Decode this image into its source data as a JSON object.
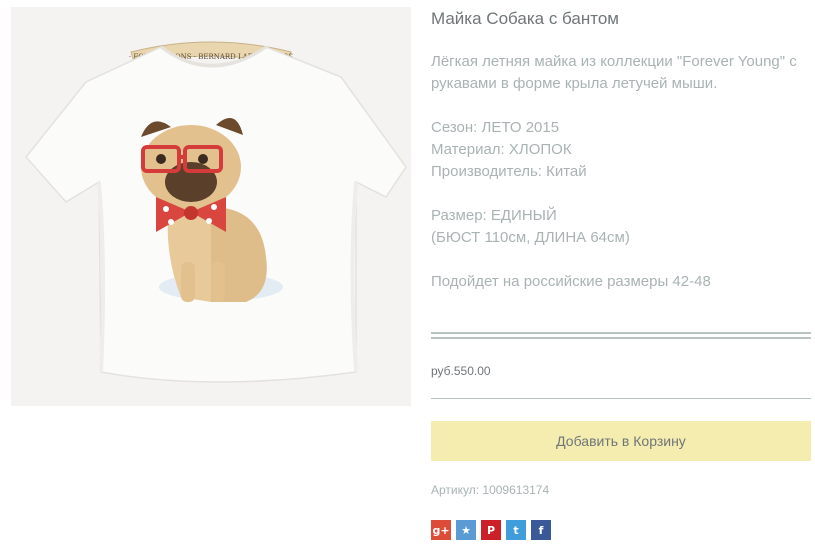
{
  "product": {
    "title": "Майка Собака с бантом",
    "description": [
      "Лёгкая летняя майка из коллекции \"Forever Young\" с рукавами в форме крыла летучей мыши.",
      "",
      "Сезон: ЛЕТО 2015",
      "Материал: ХЛОПОК",
      "Производитель: Китай",
      "",
      "Размер: ЕДИНЫЙ",
      "(БЮСТ 110см, ДЛИНА 64см)",
      "",
      "Подойдет на российские размеры 42-48"
    ],
    "price": "руб.550.00",
    "add_to_cart_label": "Добавить в Корзину",
    "sku": "Артикул: 1009613174",
    "hanger_text": "· FOURSEASONS · BERNARD LAFOND FURS"
  },
  "share": [
    {
      "icon": "google-plus-icon",
      "glyph": "g+",
      "color": "#dd4b39"
    },
    {
      "icon": "odnoklassniki-icon",
      "glyph": "★",
      "color": "#5b9bd5"
    },
    {
      "icon": "pinterest-icon",
      "glyph": "P",
      "color": "#cb2027"
    },
    {
      "icon": "twitter-icon",
      "glyph": "t",
      "color": "#3f9ddb"
    },
    {
      "icon": "facebook-icon",
      "glyph": "f",
      "color": "#3b5998"
    }
  ],
  "colors": {
    "button_bg": "#f5ecb0",
    "title_text": "#6f7678",
    "muted_text": "#a9b3b4",
    "rule": "#b9c3c2"
  }
}
